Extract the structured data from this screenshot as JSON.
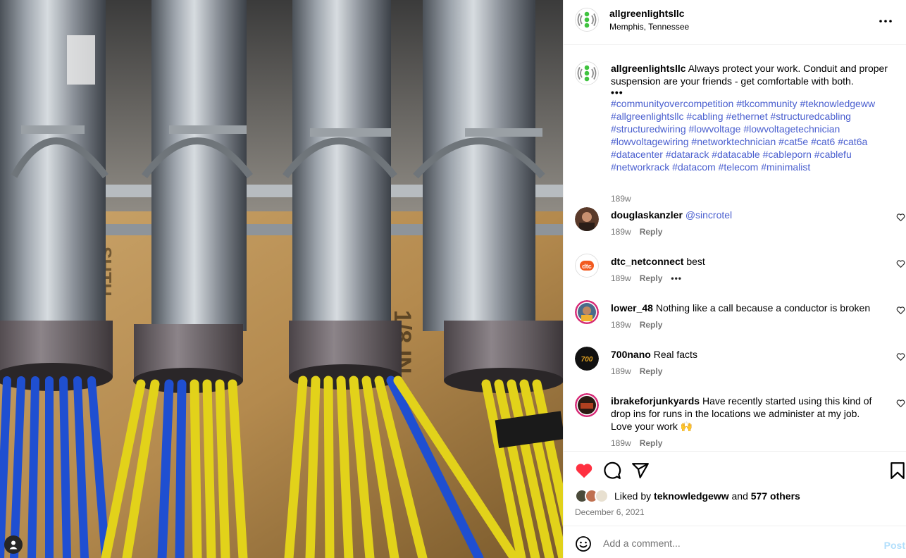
{
  "post": {
    "author": "allgreenlightsllc",
    "location": "Memphis, Tennessee"
  },
  "caption": {
    "username": "allgreenlightsllc",
    "text": "Always protect your work. Conduit and proper suspension are your friends - get comfortable with both.",
    "ellipsis": "•••",
    "hashtags": [
      "#communityovercompetition",
      "#tkcommunity",
      "#teknowledgeww",
      "#allgreenlightsllc",
      "#cabling",
      "#ethernet",
      "#structuredcabling",
      "#structuredwiring",
      "#lowvoltage",
      "#lowvoltagetechnician",
      "#lowvoltagewiring",
      "#networktechnician",
      "#cat5e",
      "#cat6",
      "#cat6a",
      "#datacenter",
      "#datarack",
      "#datacable",
      "#cableporn",
      "#cablefu",
      "#networkrack",
      "#datacom",
      "#telecom",
      "#minimalist"
    ],
    "time": "189w"
  },
  "comments": [
    {
      "username": "douglaskanzler",
      "mention": "@sincrotel",
      "text": "",
      "time": "189w",
      "reply": "Reply",
      "more": ""
    },
    {
      "username": "dtc_netconnect",
      "mention": "",
      "text": "best",
      "time": "189w",
      "reply": "Reply",
      "more": "•••"
    },
    {
      "username": "lower_48",
      "mention": "",
      "text": "Nothing like a call because a conductor is broken",
      "time": "189w",
      "reply": "Reply",
      "more": ""
    },
    {
      "username": "700nano",
      "mention": "",
      "text": "Real facts",
      "time": "189w",
      "reply": "Reply",
      "more": ""
    },
    {
      "username": "ibrakeforjunkyards",
      "mention": "",
      "text": "Have recently started using this kind of drop ins for runs in the locations we administer at my job. Love your work 🙌",
      "time": "189w",
      "reply": "Reply",
      "more": ""
    }
  ],
  "likes": {
    "prefix": "Liked by",
    "user": "teknowledgeww",
    "joiner": "and",
    "others": "577 others"
  },
  "date": "December 6, 2021",
  "add_comment": {
    "placeholder": "Add a comment...",
    "post_label": "Post"
  },
  "colors": {
    "link": "#4a5fcf",
    "heart_liked": "#ff3040",
    "post_disabled": "#b2dffc",
    "logo_green": "#3fc33f",
    "logo_gray": "#8a8a8a"
  },
  "icons": {
    "more": "more-options-icon",
    "like": "heart-filled-icon",
    "comment": "comment-icon",
    "share": "share-icon",
    "save": "bookmark-icon",
    "emoji": "emoji-icon"
  }
}
